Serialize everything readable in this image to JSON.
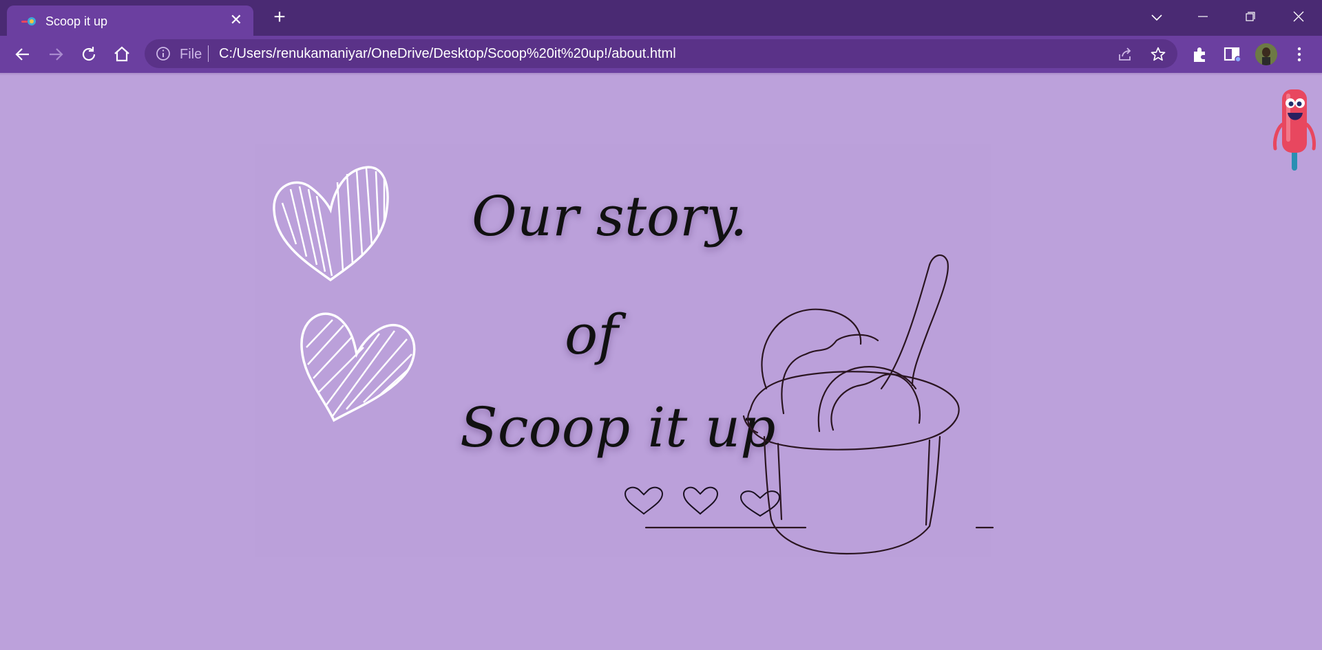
{
  "browser": {
    "tab": {
      "title": "Scoop it up"
    },
    "omnibox": {
      "scheme_label": "File",
      "url": "C:/Users/renukamaniyar/OneDrive/Desktop/Scoop%20it%20up!/about.html"
    }
  },
  "page": {
    "story": {
      "line1": "Our story.",
      "line2": "of",
      "line3": "Scoop it up"
    }
  },
  "colors": {
    "titlebar": "#4a2a73",
    "toolbar": "#6b3fa0",
    "page_bg": "#bca1db",
    "mascot": "#e8475f"
  },
  "icons": [
    "back-icon",
    "forward-icon",
    "reload-icon",
    "home-icon",
    "info-icon",
    "share-icon",
    "star-icon",
    "extensions-icon",
    "sidepanel-icon",
    "menu-icon",
    "tab-list-icon",
    "minimize-icon",
    "maximize-icon",
    "close-icon"
  ]
}
